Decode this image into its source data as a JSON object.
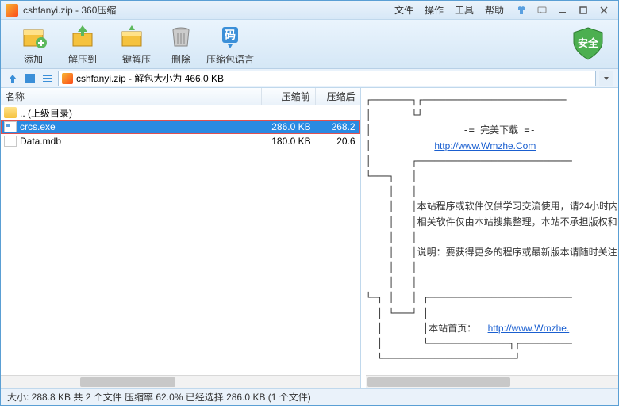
{
  "window": {
    "title": "cshfanyi.zip - 360压缩"
  },
  "menus": [
    "文件",
    "操作",
    "工具",
    "帮助"
  ],
  "toolbar": [
    {
      "label": "添加"
    },
    {
      "label": "解压到"
    },
    {
      "label": "一键解压"
    },
    {
      "label": "删除"
    },
    {
      "label": "压缩包语言"
    }
  ],
  "navbar": {
    "path": "cshfanyi.zip - 解包大小为 466.0 KB"
  },
  "columns": {
    "name": "名称",
    "before": "压缩前",
    "after": "压缩后"
  },
  "files": [
    {
      "name": ".. (上级目录)",
      "before": "",
      "after": ""
    },
    {
      "name": "crcs.exe",
      "before": "286.0 KB",
      "after": "268.2"
    },
    {
      "name": "Data.mdb",
      "before": "180.0 KB",
      "after": "20.6"
    }
  ],
  "preview": {
    "title": "完美下载",
    "link1": "http://www.Wmzhe.Com",
    "para1_l1": "本站程序或软件仅供学习交流使用，请24小时内",
    "para1_l2": "相关软件仅由本站搜集整理，本站不承担版权和",
    "para2": "说明：要获得更多的程序或最新版本请随时关注",
    "homepage_label": "本站首页：",
    "link2": "http://www.Wmzhe."
  },
  "statusbar": {
    "text": "大小: 288.8 KB 共 2 个文件 压缩率 62.0% 已经选择 286.0 KB (1 个文件)"
  }
}
